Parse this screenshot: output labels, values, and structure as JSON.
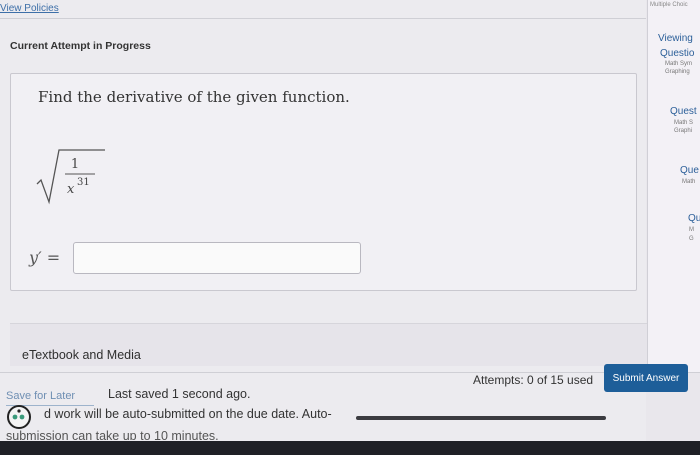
{
  "header": {
    "view_policies": "View Policies",
    "attempt_status": "Current Attempt in Progress"
  },
  "question": {
    "prompt": "Find the derivative of the given function.",
    "function_numerator": "1",
    "function_denominator_base": "x",
    "function_denominator_exponent": "31",
    "answer_label": "y′ =",
    "answer_value": ""
  },
  "etextbook": {
    "label": "eTextbook and Media"
  },
  "footer": {
    "save_later": "Save for Later",
    "last_saved": "Last saved 1 second ago.",
    "attempts": "Attempts: 0 of 15 used",
    "submit_label": "Submit Answer",
    "autosubmit_line1": "d work will be auto-submitted on the due date. Auto-",
    "autosubmit_line2": "submission can take up to 10 minutes."
  },
  "sidebar": {
    "top_label": "Multiple Choic",
    "items": [
      {
        "title": "Viewing"
      },
      {
        "title": "Questio",
        "sub1": "Math Sym",
        "sub2": "Graphing"
      },
      {
        "title": "Quest",
        "sub1": "Math S",
        "sub2": "Graphi"
      },
      {
        "title": "Que",
        "sub1": "Math"
      },
      {
        "title": "Qu",
        "sub1": "M",
        "sub2": "G"
      }
    ]
  },
  "colors": {
    "accent": "#1d5e99",
    "link": "#3d6fa8"
  }
}
